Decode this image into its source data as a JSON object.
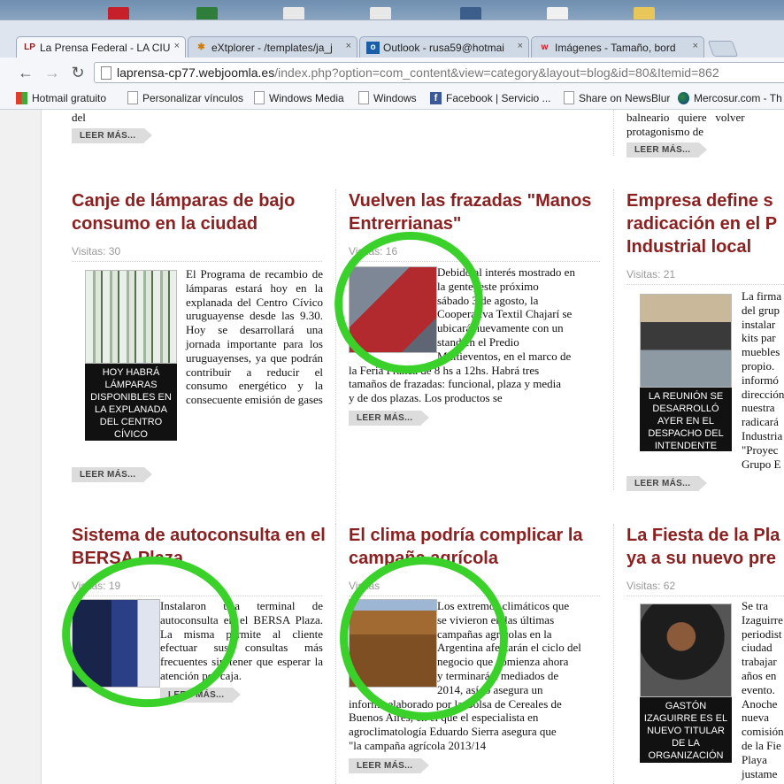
{
  "browser": {
    "tabs": [
      {
        "label": "La Prensa Federal - LA CIU",
        "icon": "lp-logo-icon"
      },
      {
        "label": "eXtplorer - /templates/ja_j",
        "icon": "extplorer-icon"
      },
      {
        "label": "Outlook - rusa59@hotmai",
        "icon": "outlook-icon"
      },
      {
        "label": "Imágenes - Tamaño, bord",
        "icon": "images-site-icon"
      }
    ],
    "tab_close": "×",
    "url_domain": "laprensa-cp77.webjoomla.es",
    "url_path": "/index.php?option=com_content&view=category&layout=blog&id=80&Itemid=862",
    "bookmarks": [
      {
        "label": "Hotmail gratuito",
        "icon": "windows-icon"
      },
      {
        "label": "Personalizar vínculos",
        "icon": "page-icon"
      },
      {
        "label": "Windows Media",
        "icon": "page-icon"
      },
      {
        "label": "Windows",
        "icon": "page-icon"
      },
      {
        "label": "Facebook | Servicio ...",
        "icon": "facebook-icon"
      },
      {
        "label": "Share on NewsBlur",
        "icon": "page-icon"
      },
      {
        "label": "Mercosur.com - Th",
        "icon": "mercosur-icon"
      }
    ]
  },
  "accent_color": "#8b2020",
  "annotation_color": "#3ad12a",
  "top_fragments": {
    "left_tail": "del",
    "right_tail_1": "balneario   quiere   volver",
    "right_tail_2": "protagonismo de"
  },
  "read_more": "LEER MÁS...",
  "articles": [
    {
      "title": "Canje de lámparas de bajo consumo en la ciudad",
      "hits": "Visitas: 30",
      "body": "El Programa de recambio de lámparas estará hoy en la explanada del Centro Cívico uruguayense desde las 9.30. Hoy se desarrollará una jornada importante para los uruguayenses, ya que podrán contribuir a reducir el consumo energético y la consecuente emisión de gases",
      "caption": "HOY HABRÁ LÁMPARAS DISPONIBLES EN LA EXPLANADA DEL CENTRO CÍVICO"
    },
    {
      "title": "Vuelven las frazadas \"Manos Entrerrianas\"",
      "hits": "Visitas: 16",
      "body_lines": [
        "Debido al interés mostrado en",
        "la gente, este próximo",
        "sábado 3 de agosto, la",
        "Cooperativa Textil Chajarí se",
        "ubicará nuevamente con un",
        "stand en el Predio",
        "Multieventos, en el marco de",
        "la Feria Franca de 8 hs a 12hs. Habrá tres",
        "tamaños de frazadas: funcional, plaza y media",
        "y de dos plazas. Los productos se"
      ]
    },
    {
      "title": "Empresa define s radicación en el P Industrial local",
      "title_lines": [
        "Empresa define s",
        "radicación en el P",
        "Industrial local"
      ],
      "hits": "Visitas: 21",
      "body_lines": [
        "La firma",
        "del grup",
        "instalar",
        "kits par",
        "muebles",
        "propio.",
        "informó",
        "dirección",
        "nuestra",
        "radicará",
        "Industria",
        "\"Proyec",
        "Grupo E"
      ],
      "caption": "LA REUNIÓN SE DESARROLLÓ AYER EN EL DESPACHO DEL INTENDENTE"
    },
    {
      "title": "Sistema de autoconsulta en el BERSA Plaza",
      "hits": "Visitas: 19",
      "body": "Instalaron una terminal de autoconsulta en el BERSA Plaza. La misma permite al cliente efectuar sus consultas más frecuentes sin tener que esperar la atención por caja."
    },
    {
      "title": "El clima podría complicar la campaña agrícola",
      "hits": "Visitas",
      "body_lines": [
        "Los extremos climáticos que",
        "se vivieron en las últimas",
        "campañas agrícolas en la",
        "Argentina afectarán el ciclo del",
        "negocio que comienza ahora",
        "y terminará a mediados de",
        "2014, así lo asegura un",
        "informe elaborado por la Bolsa de Cereales de",
        "Buenos Aires, en el que el especialista en",
        "agroclimatología Eduardo Sierra asegura que",
        "\"la campaña agrícola 2013/14"
      ]
    },
    {
      "title_lines": [
        "La Fiesta de la Pla",
        "ya a su nuevo pre"
      ],
      "hits": "Visitas: 62",
      "body_lines": [
        "Se tra",
        "Izaguirre",
        "periodist",
        "ciudad",
        "trabajar",
        "años en",
        "evento.",
        "Anoche",
        "nueva",
        "comisión",
        "de la Fie",
        "Playa",
        "justame"
      ],
      "caption": "GASTÓN IZAGUIRRE ES EL NUEVO TITULAR DE LA ORGANIZACIÓN"
    }
  ]
}
